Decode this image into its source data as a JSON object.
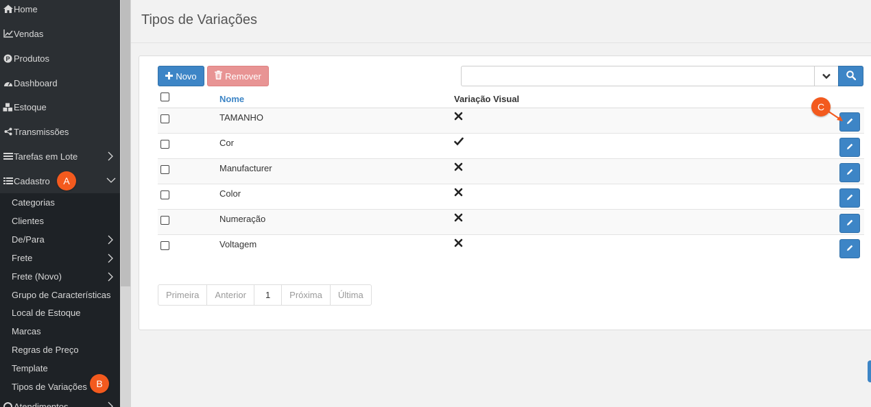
{
  "sidebar": {
    "items": [
      {
        "label": "Home",
        "icon": "home-icon"
      },
      {
        "label": "Vendas",
        "icon": "chart-line-icon"
      },
      {
        "label": "Produtos",
        "icon": "product-icon"
      },
      {
        "label": "Dashboard",
        "icon": "dashboard-icon"
      },
      {
        "label": "Estoque",
        "icon": "cubes-icon"
      },
      {
        "label": "Transmissões",
        "icon": "share-icon"
      },
      {
        "label": "Tarefas em Lote",
        "icon": "tasks-icon"
      },
      {
        "label": "Cadastro",
        "icon": "list-icon"
      },
      {
        "label": "Atendimentos",
        "icon": "support-icon"
      }
    ],
    "submenu": [
      {
        "label": "Categorias"
      },
      {
        "label": "Clientes"
      },
      {
        "label": "De/Para"
      },
      {
        "label": "Frete"
      },
      {
        "label": "Frete (Novo)"
      },
      {
        "label": "Grupo de Características"
      },
      {
        "label": "Local de Estoque"
      },
      {
        "label": "Marcas"
      },
      {
        "label": "Regras de Preço"
      },
      {
        "label": "Template"
      },
      {
        "label": "Tipos de Variações"
      }
    ]
  },
  "annotations": {
    "a": "A",
    "b": "B",
    "c": "C"
  },
  "page": {
    "title": "Tipos de Variações"
  },
  "toolbar": {
    "new_label": "Novo",
    "remove_label": "Remover"
  },
  "search": {
    "value": "",
    "placeholder": ""
  },
  "table": {
    "headers": {
      "name": "Nome",
      "visual": "Variação Visual"
    },
    "rows": [
      {
        "name": "TAMANHO",
        "visual": false
      },
      {
        "name": "Cor",
        "visual": true
      },
      {
        "name": "Manufacturer",
        "visual": false
      },
      {
        "name": "Color",
        "visual": false
      },
      {
        "name": "Numeração",
        "visual": false
      },
      {
        "name": "Voltagem",
        "visual": false
      }
    ]
  },
  "pagination": {
    "first": "Primeira",
    "prev": "Anterior",
    "current": "1",
    "next": "Próxima",
    "last": "Última"
  },
  "colors": {
    "primary": "#3d85c6",
    "danger_disabled": "#e89494",
    "sidebar_bg": "#2b2f33",
    "submenu_bg": "#1e2226",
    "annotation": "#f35a1e"
  }
}
